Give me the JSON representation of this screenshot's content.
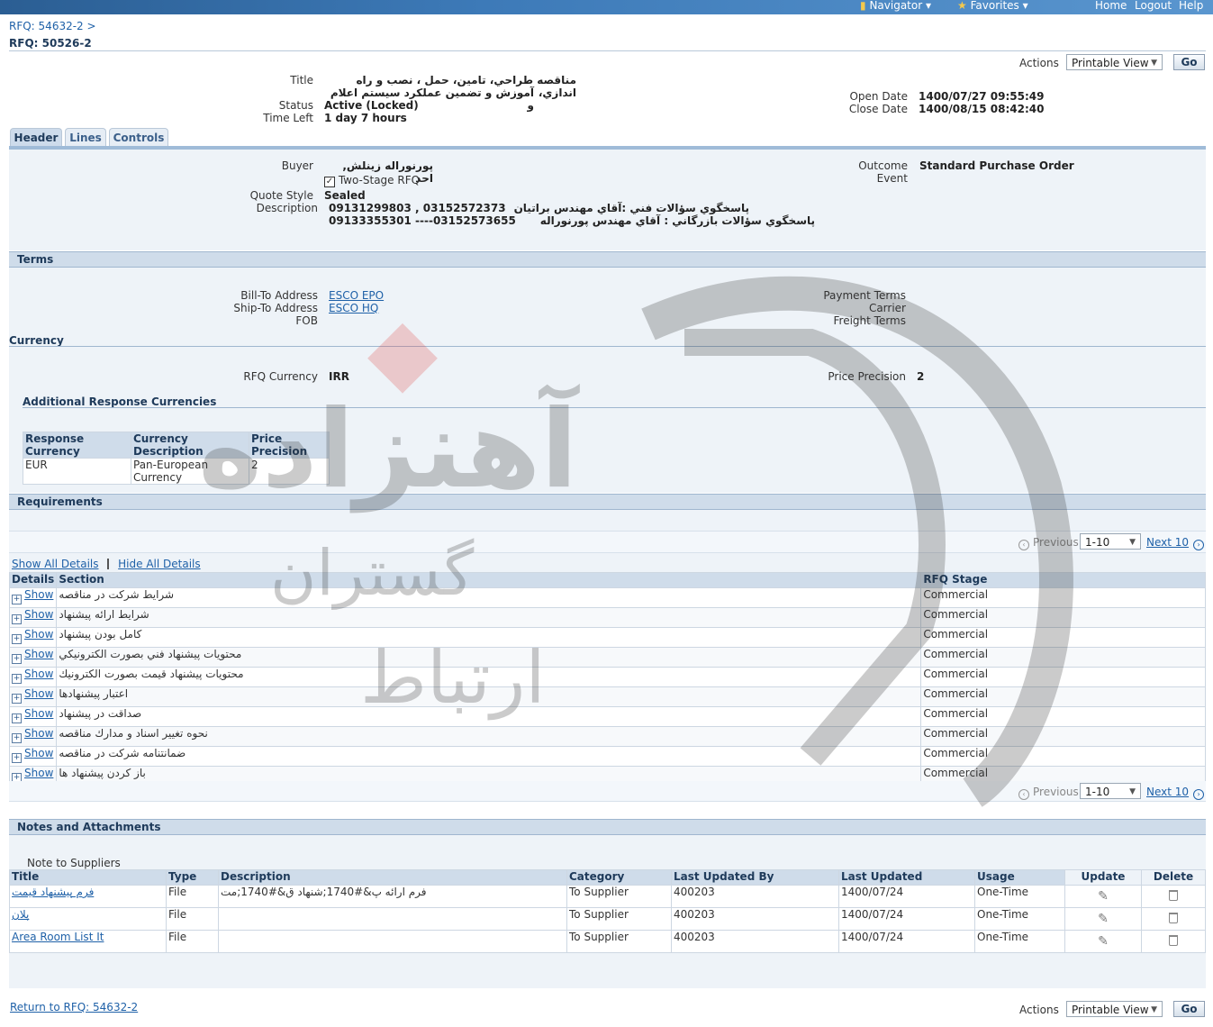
{
  "topnav": {
    "navigator": "Navigator",
    "favorites": "Favorites",
    "home": "Home",
    "logout": "Logout",
    "help": "Help"
  },
  "breadcrumb": {
    "parent": "RFQ: 54632-2",
    "sep": ">",
    "current": "RFQ: 50526-2"
  },
  "actions": {
    "label": "Actions",
    "selected": "Printable View",
    "go": "Go"
  },
  "summary": {
    "title_label": "Title",
    "title_line1": "مناقصه طراحي، تامين، حمل ، نصب و راه اندازي،",
    "title_line2": "آموزش و تضمين عملكرد سيستم اعلام و",
    "status_label": "Status",
    "status": "Active (Locked)",
    "time_left_label": "Time Left",
    "time_left": "1 day 7 hours",
    "open_date_label": "Open Date",
    "open_date": "1400/07/27 09:55:49",
    "close_date_label": "Close Date",
    "close_date": "1400/08/15 08:42:40"
  },
  "tabs": [
    "Header",
    "Lines",
    "Controls"
  ],
  "header": {
    "buyer_label": "Buyer",
    "buyer": "پورنوراله زينلش, احد",
    "two_stage": "Two-Stage RFQ",
    "quote_style_label": "Quote Style",
    "quote_style": "Sealed",
    "description_label": "Description",
    "desc_line1_phones": "09131299803 , 03152572373",
    "desc_line1_text": "پاسخگوي سؤالات فني :آقاي مهندس براتيان",
    "desc_line2_phones": "09133355301 ----03152573655",
    "desc_line2_text": "پاسخگوي سؤالات بازرگاني : آقاي مهندس  پورنوراله",
    "outcome_label": "Outcome",
    "outcome": "Standard Purchase Order",
    "event_label": "Event"
  },
  "terms": {
    "heading": "Terms",
    "bill_to_label": "Bill-To Address",
    "bill_to": "ESCO EPO",
    "ship_to_label": "Ship-To Address",
    "ship_to": "ESCO HQ",
    "fob_label": "FOB",
    "payment_terms_label": "Payment Terms",
    "carrier_label": "Carrier",
    "freight_terms_label": "Freight Terms"
  },
  "currency": {
    "heading": "Currency",
    "rfq_currency_label": "RFQ Currency",
    "rfq_currency": "IRR",
    "price_precision_label": "Price Precision",
    "price_precision": "2",
    "additional_heading": "Additional Response Currencies",
    "columns": [
      "Response Currency",
      "Currency Description",
      "Price Precision"
    ],
    "rows": [
      [
        "EUR",
        "Pan-European Currency",
        "2"
      ]
    ]
  },
  "requirements": {
    "heading": "Requirements",
    "previous": "Previous",
    "range": "1-10",
    "next": "Next 10",
    "show_all": "Show All Details",
    "hide_all": "Hide All Details",
    "columns": [
      "Details",
      "Section",
      "RFQ Stage"
    ],
    "show_label": "Show",
    "rows": [
      {
        "section": "شرايط شركت در مناقصه",
        "stage": "Commercial"
      },
      {
        "section": "شرايط ارائه پيشنهاد",
        "stage": "Commercial"
      },
      {
        "section": "كامل بودن پيشنهاد",
        "stage": "Commercial"
      },
      {
        "section": "محتويات پيشنهاد فني بصورت الكترونيكي",
        "stage": "Commercial"
      },
      {
        "section": "محتويات پيشنهاد قيمت بصورت الكترونيك",
        "stage": "Commercial"
      },
      {
        "section": "اعتبار پيشنهادها",
        "stage": "Commercial"
      },
      {
        "section": "صداقت در پيشنهاد",
        "stage": "Commercial"
      },
      {
        "section": "نحوه تغيير اسناد و مدارك مناقصه",
        "stage": "Commercial"
      },
      {
        "section": "ضمانتنامه شركت در مناقصه",
        "stage": "Commercial"
      },
      {
        "section": "باز كردن پيشنهاد ها",
        "stage": "Commercial"
      }
    ]
  },
  "notes": {
    "heading": "Notes and Attachments",
    "note_label": "Note to Suppliers",
    "columns": [
      "Title",
      "Type",
      "Description",
      "Category",
      "Last Updated By",
      "Last Updated",
      "Usage",
      "Update",
      "Delete"
    ],
    "rows": [
      {
        "title": "فرم پيشنهاد قيمت",
        "type": "File",
        "description": "فرم ارائه پ&#1740;شنهاد ق&#1740;مت",
        "category": "To Supplier",
        "updated_by": "400203",
        "updated": "1400/07/24",
        "usage": "One-Time"
      },
      {
        "title": "پلان",
        "type": "File",
        "description": "",
        "category": "To Supplier",
        "updated_by": "400203",
        "updated": "1400/07/24",
        "usage": "One-Time"
      },
      {
        "title": "Area Room List It",
        "type": "File",
        "description": "",
        "category": "To Supplier",
        "updated_by": "400203",
        "updated": "1400/07/24",
        "usage": "One-Time"
      }
    ]
  },
  "footer": {
    "return_link": "Return to RFQ: 54632-2"
  },
  "watermark": {
    "text1": "آهنزاده",
    "text2": "گستران",
    "text3": "ارتباط"
  },
  "colors": {
    "accent": "#1f61a8",
    "section_bar": "#cfdcea",
    "panel": "#eef3f8"
  }
}
